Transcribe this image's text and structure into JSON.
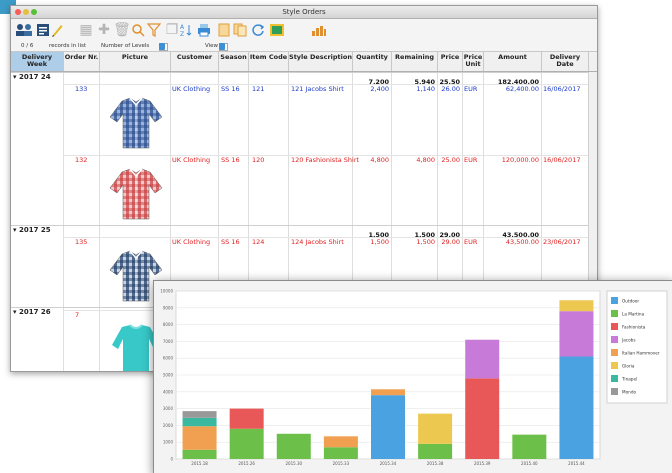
{
  "window": {
    "title": "Style Orders"
  },
  "status": {
    "count": "0 / 6",
    "records_label": "records in list",
    "levels_label": "Number of Levels",
    "levels_value": "1",
    "view_label": "View",
    "view_value": "0"
  },
  "columns": [
    {
      "label": "Delivery\nWeek"
    },
    {
      "label": "Order Nr."
    },
    {
      "label": "Picture"
    },
    {
      "label": "Customer"
    },
    {
      "label": "Season"
    },
    {
      "label": "Item Code"
    },
    {
      "label": "Style Description"
    },
    {
      "label": "Quantity"
    },
    {
      "label": "Remaining"
    },
    {
      "label": "Price"
    },
    {
      "label": "Price\nUnit"
    },
    {
      "label": "Amount"
    },
    {
      "label": "Delivery\nDate"
    }
  ],
  "groups": [
    {
      "week": "2017 24",
      "quantity": "7,200",
      "remaining": "5,940",
      "price": "25.50",
      "amount": "182,400.00",
      "orders": [
        {
          "order": "133",
          "customer": "UK Clothing",
          "season": "SS 16",
          "item": "121",
          "desc": "121 Jacobs Shirt",
          "quantity": "2,400",
          "remaining": "1,140",
          "price": "26.00",
          "unit": "EUR",
          "amount": "62,400.00",
          "date": "16/06/2017",
          "color": "#1a39c9"
        },
        {
          "order": "132",
          "customer": "UK Clothing",
          "season": "SS 16",
          "item": "120",
          "desc": "120 Fashionista Shirt",
          "quantity": "4,800",
          "remaining": "4,800",
          "price": "25.00",
          "unit": "EUR",
          "amount": "120,000.00",
          "date": "16/06/2017",
          "color": "#e02020"
        }
      ]
    },
    {
      "week": "2017 25",
      "quantity": "1,500",
      "remaining": "1,500",
      "price": "29.00",
      "amount": "43,500.00",
      "orders": [
        {
          "order": "135",
          "customer": "UK Clothing",
          "season": "SS 16",
          "item": "124",
          "desc": "124 Jacobs Shirt",
          "quantity": "1,500",
          "remaining": "1,500",
          "price": "29.00",
          "unit": "EUR",
          "amount": "43,500.00",
          "date": "23/06/2017",
          "color": "#e02020"
        }
      ]
    },
    {
      "week": "2017 26",
      "orders": [
        {
          "order": "7",
          "color": "#e02020"
        }
      ]
    }
  ],
  "icons": [
    "customers-icon",
    "list-icon",
    "edit-icon",
    "grid-icon",
    "add-icon",
    "trash-icon",
    "search-icon",
    "filter-icon",
    "copy-icon",
    "sort-icon",
    "print-icon",
    "document-icon",
    "duplicate-icon",
    "refresh-icon",
    "export-icon",
    "chart-icon"
  ],
  "chart_data": {
    "type": "bar",
    "stacked": true,
    "categories": [
      "2015.18",
      "2015.26",
      "2015.30",
      "2015.33",
      "2015.34",
      "2015.38",
      "2015.39",
      "2015.40",
      "2015.44"
    ],
    "series": [
      {
        "name": "Outdoor",
        "color": "#4aa3e0",
        "values": [
          0,
          0,
          0,
          0,
          3800,
          0,
          0,
          0,
          6100
        ]
      },
      {
        "name": "La Martina",
        "color": "#6cc04a",
        "values": [
          550,
          1800,
          1500,
          700,
          0,
          900,
          0,
          1450,
          0
        ]
      },
      {
        "name": "Fashionista",
        "color": "#e85858",
        "values": [
          0,
          1200,
          0,
          0,
          0,
          0,
          4800,
          0,
          0
        ]
      },
      {
        "name": "Jacobs",
        "color": "#c87ad8",
        "values": [
          0,
          0,
          0,
          0,
          0,
          0,
          2300,
          0,
          2700
        ]
      },
      {
        "name": "Italian Hammover",
        "color": "#f0a050",
        "values": [
          1400,
          0,
          0,
          650,
          350,
          0,
          0,
          0,
          0
        ]
      },
      {
        "name": "Gloria",
        "color": "#ecc850",
        "values": [
          0,
          0,
          0,
          0,
          0,
          1800,
          0,
          0,
          650
        ]
      },
      {
        "name": "Tinapel",
        "color": "#3ab8a0",
        "values": [
          500,
          0,
          0,
          0,
          0,
          0,
          0,
          0,
          0
        ]
      },
      {
        "name": "Mondo",
        "color": "#999999",
        "values": [
          400,
          0,
          0,
          0,
          0,
          0,
          0,
          0,
          0
        ]
      }
    ],
    "y_ticks": [
      0,
      1000,
      2000,
      3000,
      4000,
      5000,
      6000,
      7000,
      8000,
      9000,
      10000
    ],
    "ylim": [
      0,
      10000
    ],
    "legend": "right",
    "grid": true
  }
}
